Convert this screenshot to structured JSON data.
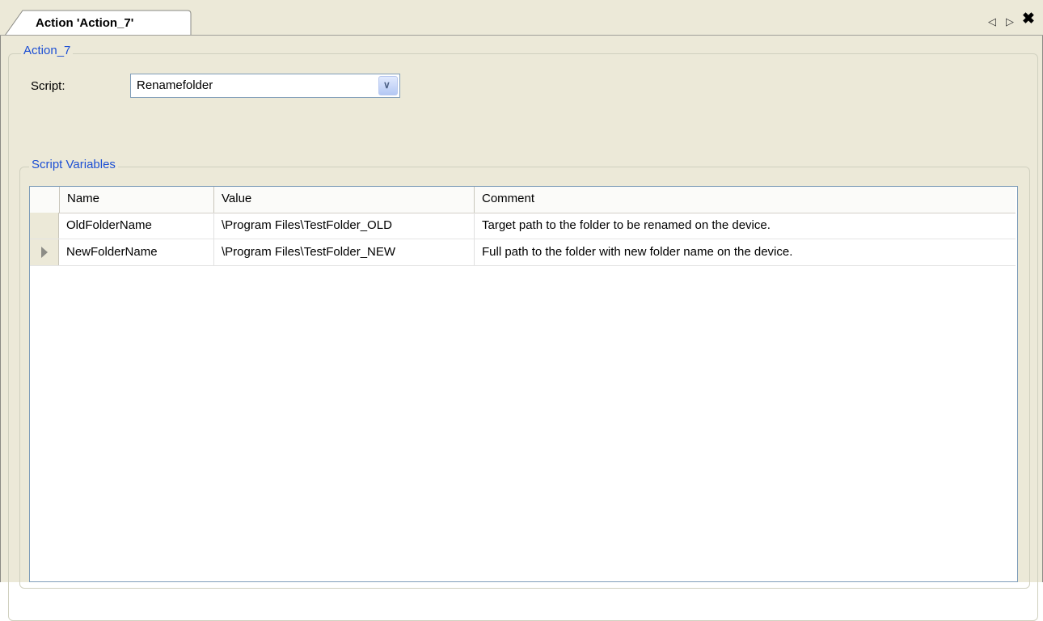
{
  "tab": {
    "title": "Action 'Action_7'"
  },
  "tab_controls": {
    "prev_icon": "◁",
    "next_icon": "▷",
    "close_icon": "✖"
  },
  "action_group": {
    "legend": "Action_7"
  },
  "script": {
    "label": "Script:",
    "selected": "Renamefolder"
  },
  "variables": {
    "legend": "Script Variables",
    "columns": [
      "Name",
      "Value",
      "Comment"
    ],
    "rows": [
      {
        "name": "OldFolderName",
        "value": "\\Program Files\\TestFolder_OLD",
        "comment": "Target path to the folder to be renamed on the device.",
        "current": false
      },
      {
        "name": "NewFolderName",
        "value": "\\Program Files\\TestFolder_NEW",
        "comment": "Full path to the folder with new folder name on the device.",
        "current": true
      }
    ]
  },
  "colors": {
    "accent": "#1c4fd4",
    "panel": "#ece9d8"
  }
}
